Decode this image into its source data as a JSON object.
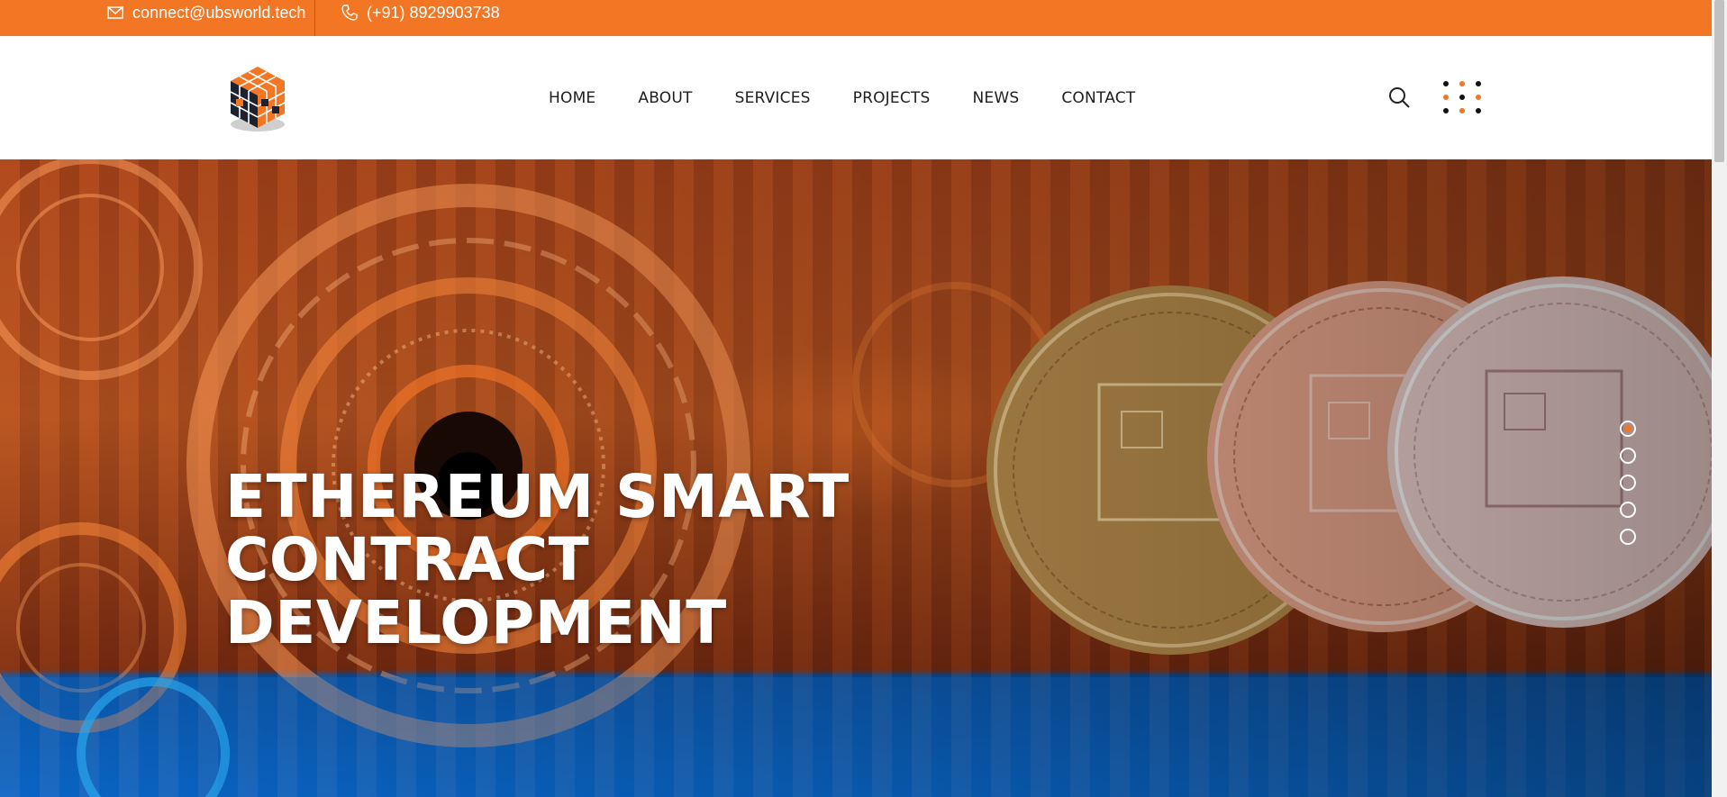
{
  "topbar": {
    "email": "connect@ubsworld.tech",
    "phone": "(+91) 8929903738",
    "email_icon": "envelope-icon",
    "phone_icon": "phone-icon",
    "background": "#f27623"
  },
  "header": {
    "logo_icon": "cube-logo-icon",
    "nav": [
      {
        "label": "HOME"
      },
      {
        "label": "ABOUT"
      },
      {
        "label": "SERVICES"
      },
      {
        "label": "PROJECTS"
      },
      {
        "label": "NEWS"
      },
      {
        "label": "CONTACT"
      }
    ],
    "search_icon": "search-icon",
    "menu_icon": "dots-grid-icon"
  },
  "hero": {
    "title_line1": "ETHEREUM SMART CONTRACT",
    "title_line2": "DEVELOPMENT",
    "slides_total": 5,
    "active_slide": 1
  },
  "colors": {
    "accent": "#f27623",
    "nav_text": "#1e1e1e"
  }
}
